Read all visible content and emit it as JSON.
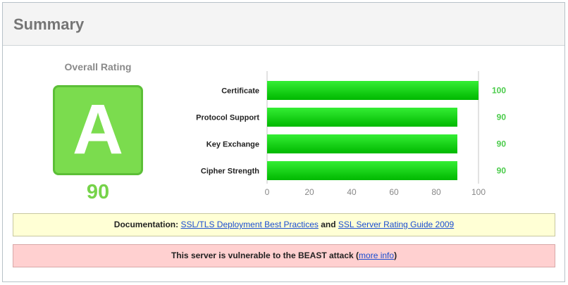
{
  "header": {
    "title": "Summary"
  },
  "rating": {
    "label": "Overall Rating",
    "grade": "A",
    "score": "90"
  },
  "colors": {
    "bar_top": "#34ee34",
    "bar_bottom": "#00b800",
    "value_text": "#4ccc4c",
    "grade_fill": "#7bdc4e"
  },
  "chart_data": {
    "type": "bar",
    "orientation": "horizontal",
    "categories": [
      "Certificate",
      "Protocol Support",
      "Key Exchange",
      "Cipher Strength"
    ],
    "values": [
      100,
      90,
      90,
      90
    ],
    "value_labels": [
      "100",
      "90",
      "90",
      "90"
    ],
    "xlim": [
      0,
      100
    ],
    "xticks": [
      "0",
      "20",
      "40",
      "60",
      "80",
      "100"
    ],
    "grid": true
  },
  "documentation": {
    "prefix": "Documentation: ",
    "link1": "SSL/TLS Deployment Best Practices",
    "middle": " and ",
    "link2": " SSL Server Rating Guide 2009"
  },
  "warning": {
    "text": "This server is vulnerable to the BEAST attack (",
    "link": "more info",
    "suffix": ")"
  }
}
